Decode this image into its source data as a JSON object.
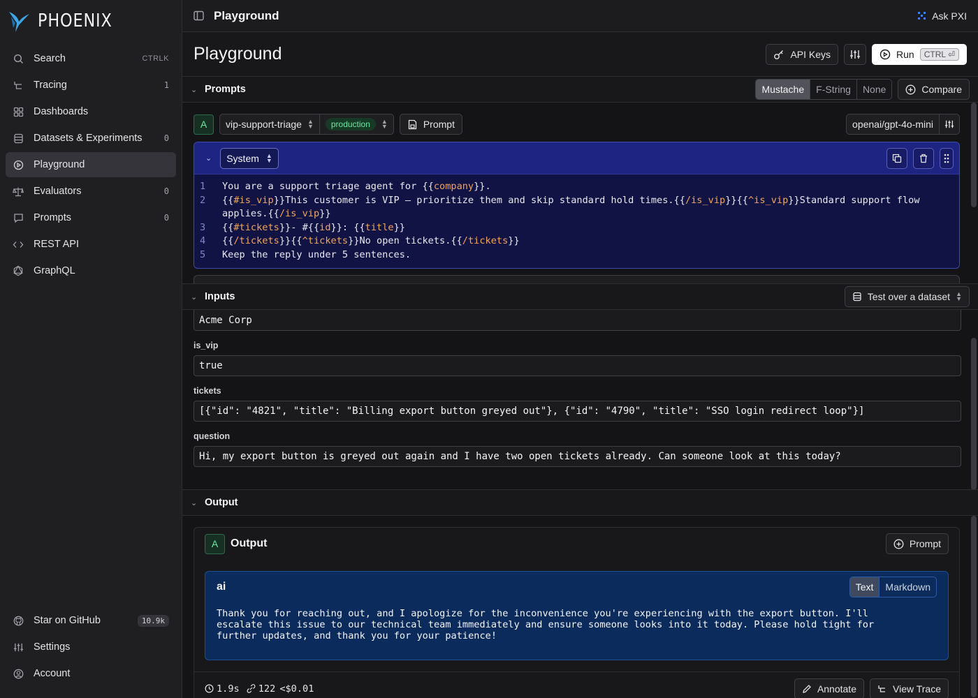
{
  "brand": {
    "name": "PHOENIX"
  },
  "sidebar": {
    "items": [
      {
        "label": "Search",
        "kbd": "CTRLK",
        "icon": "search-icon"
      },
      {
        "label": "Tracing",
        "count": "1",
        "icon": "tracing-icon"
      },
      {
        "label": "Dashboards",
        "icon": "dashboards-icon"
      },
      {
        "label": "Datasets & Experiments",
        "count": "0",
        "icon": "database-icon"
      },
      {
        "label": "Playground",
        "icon": "playground-icon",
        "active": true
      },
      {
        "label": "Evaluators",
        "count": "0",
        "icon": "scale-icon"
      },
      {
        "label": "Prompts",
        "count": "0",
        "icon": "message-icon"
      },
      {
        "label": "REST API",
        "icon": "code-icon"
      },
      {
        "label": "GraphQL",
        "icon": "graphql-icon"
      }
    ],
    "bottom": [
      {
        "label": "Star on GitHub",
        "badge": "10.9k",
        "icon": "github-icon"
      },
      {
        "label": "Settings",
        "icon": "settings-icon"
      },
      {
        "label": "Account",
        "icon": "account-icon"
      }
    ]
  },
  "topbar": {
    "title": "Playground",
    "ask_label": "Ask PXI"
  },
  "page": {
    "title": "Playground",
    "api_keys_label": "API Keys",
    "run_label": "Run",
    "run_kbd": "CTRL ⏎"
  },
  "prompts": {
    "section_title": "Prompts",
    "template_formats": [
      "Mustache",
      "F-String",
      "None"
    ],
    "active_format": "Mustache",
    "compare_label": "Compare",
    "instance_letter": "A",
    "prompt_name": "vip-support-triage",
    "prompt_tag": "production",
    "prompt_button_label": "Prompt",
    "model": "openai/gpt-4o-mini",
    "message": {
      "role": "System",
      "lines": [
        {
          "n": "1",
          "parts": [
            [
              "t",
              "You are a support triage agent for {{"
            ],
            [
              "v",
              "company"
            ],
            [
              "t",
              "}}."
            ]
          ]
        },
        {
          "n": "2",
          "parts": [
            [
              "t",
              "{{"
            ],
            [
              "v",
              "#is_vip"
            ],
            [
              "t",
              "}}This customer is VIP — prioritize them and skip standard hold times.{{"
            ],
            [
              "v",
              "/is_vip"
            ],
            [
              "t",
              "}}{{"
            ],
            [
              "v",
              "^is_vip"
            ],
            [
              "t",
              "}}Standard support flow applies.{{"
            ],
            [
              "v",
              "/is_vip"
            ],
            [
              "t",
              "}}"
            ]
          ]
        },
        {
          "n": "3",
          "parts": [
            [
              "t",
              "{{"
            ],
            [
              "v",
              "#tickets"
            ],
            [
              "t",
              "}}- #{{"
            ],
            [
              "v",
              "id"
            ],
            [
              "t",
              "}}: {{"
            ],
            [
              "v",
              "title"
            ],
            [
              "t",
              "}}"
            ]
          ]
        },
        {
          "n": "4",
          "parts": [
            [
              "t",
              "{{"
            ],
            [
              "v",
              "/tickets"
            ],
            [
              "t",
              "}}{{"
            ],
            [
              "v",
              "^tickets"
            ],
            [
              "t",
              "}}No open tickets.{{"
            ],
            [
              "v",
              "/tickets"
            ],
            [
              "t",
              "}}"
            ]
          ]
        },
        {
          "n": "5",
          "parts": [
            [
              "t",
              "Keep the reply under 5 sentences."
            ]
          ]
        }
      ]
    }
  },
  "inputs": {
    "section_title": "Inputs",
    "dataset_label": "Test over a dataset",
    "company_value": "Acme Corp",
    "fields": [
      {
        "name": "is_vip",
        "value": "true"
      },
      {
        "name": "tickets",
        "value": "[{\"id\": \"4821\", \"title\": \"Billing export button greyed out\"}, {\"id\": \"4790\", \"title\": \"SSO login redirect loop\"}]"
      },
      {
        "name": "question",
        "value": "Hi, my export button is greyed out again and I have two open tickets already. Can someone look at this today?"
      }
    ]
  },
  "output": {
    "section_title": "Output",
    "card_letter": "A",
    "card_title": "Output",
    "prompt_button_label": "Prompt",
    "role": "ai",
    "view_modes": [
      "Text",
      "Markdown"
    ],
    "active_view": "Text",
    "text_lines": [
      "Thank you for reaching out, and I apologize for the inconvenience you're experiencing with the export button. I'll",
      "escalate this issue to our technical team immediately and ensure someone looks into it today. Please hold tight for",
      "further updates, and thank you for your patience!"
    ],
    "latency": "1.9s",
    "tokens": "122",
    "cost": "<$0.01",
    "annotate_label": "Annotate",
    "view_trace_label": "View Trace"
  },
  "colors": {
    "accent_system": "#1e2482",
    "accent_ai": "#0b2b5c",
    "template_var": "#f2a55a",
    "tag_green": "#6ee7a0"
  }
}
